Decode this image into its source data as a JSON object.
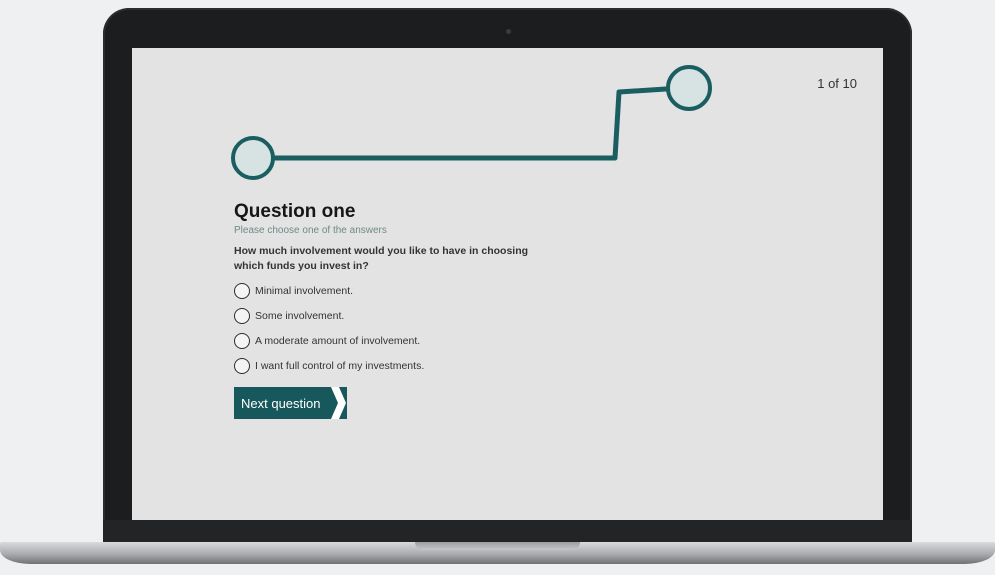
{
  "progress": {
    "counter": "1 of 10",
    "current": 1,
    "total": 10,
    "colors": {
      "line": "#1a5e61",
      "node_fill": "#d7e2e3"
    }
  },
  "question": {
    "title": "Question one",
    "instruction": "Please choose one of the answers",
    "text": "How much involvement would you like to have in choosing which funds you invest in?",
    "options": [
      {
        "label": "Minimal involvement.",
        "selected": false
      },
      {
        "label": "Some involvement.",
        "selected": false
      },
      {
        "label": "A moderate amount of involvement.",
        "selected": false
      },
      {
        "label": "I want full control of my investments.",
        "selected": false
      }
    ]
  },
  "actions": {
    "next_label": "Next question",
    "next_icon": "chevron-right-icon",
    "color": "#16585c"
  }
}
